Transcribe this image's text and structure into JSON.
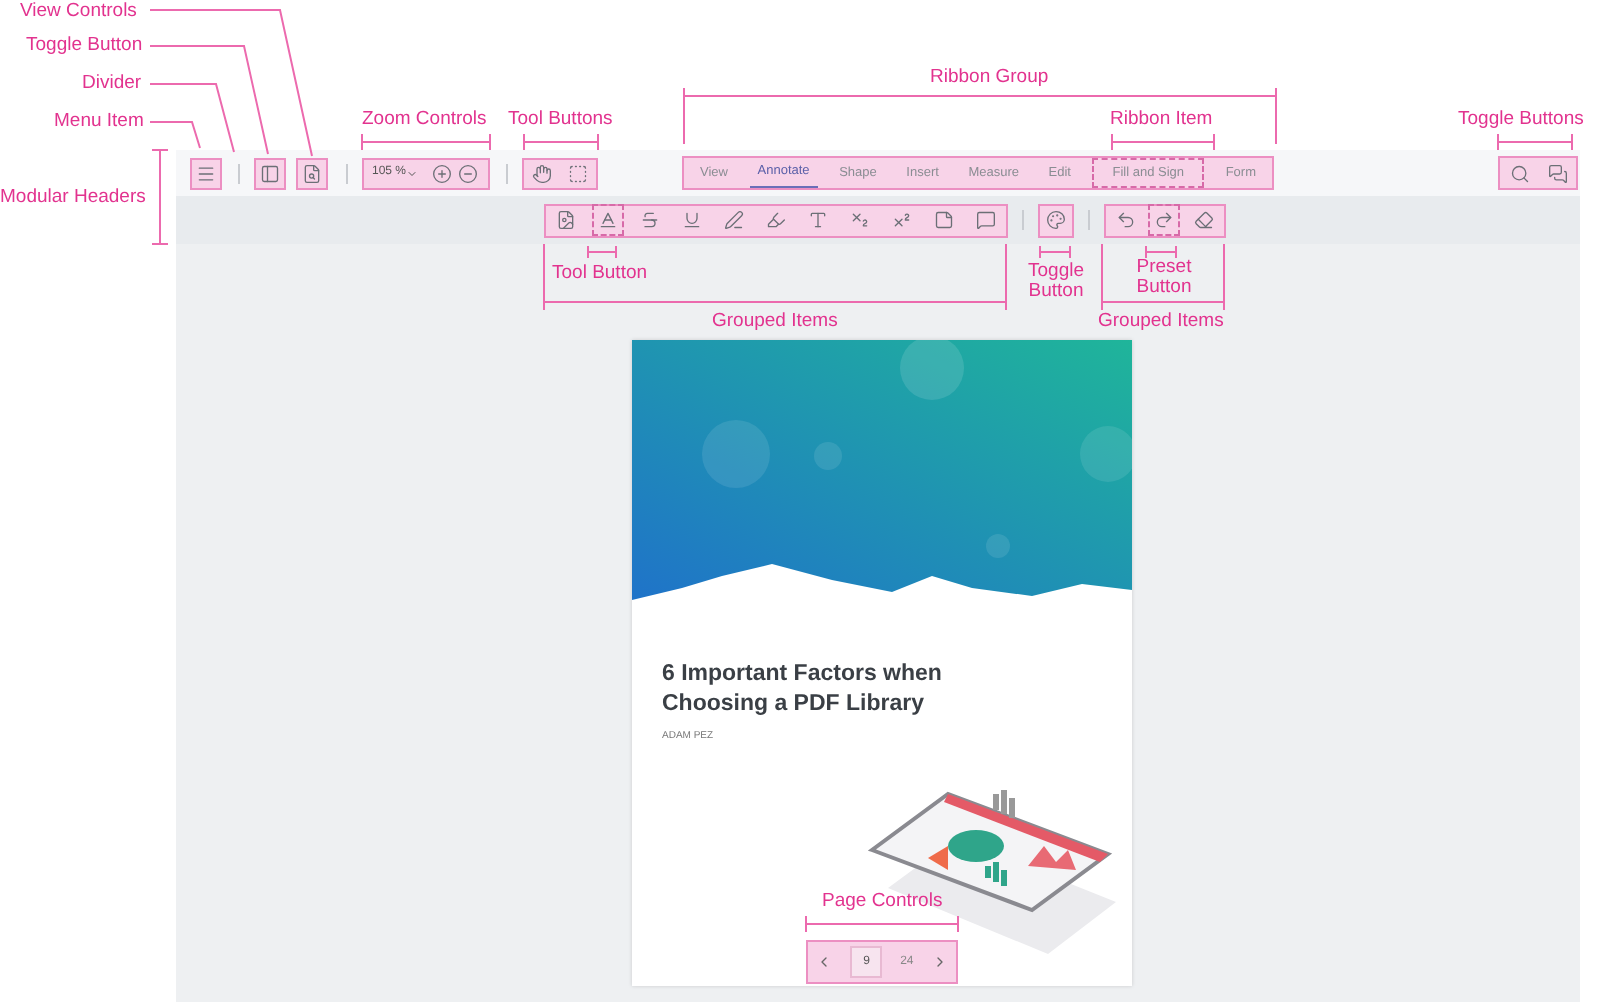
{
  "header_top": {
    "zoom": {
      "value": "105 %"
    },
    "ribbon": [
      {
        "label": "View",
        "selected": false,
        "outlined": false
      },
      {
        "label": "Annotate",
        "selected": true,
        "outlined": false
      },
      {
        "label": "Shape",
        "selected": false,
        "outlined": false
      },
      {
        "label": "Insert",
        "selected": false,
        "outlined": false
      },
      {
        "label": "Measure",
        "selected": false,
        "outlined": false
      },
      {
        "label": "Edit",
        "selected": false,
        "outlined": false
      },
      {
        "label": "Fill and Sign",
        "selected": false,
        "outlined": true
      },
      {
        "label": "Form",
        "selected": false,
        "outlined": false
      }
    ]
  },
  "header_tools": {
    "tools": [
      {
        "outlined": false
      },
      {
        "outlined": true
      },
      {
        "outlined": false
      },
      {
        "outlined": false
      },
      {
        "outlined": false
      },
      {
        "outlined": false
      },
      {
        "outlined": false
      },
      {
        "outlined": false
      },
      {
        "outlined": false
      },
      {
        "outlined": false
      },
      {
        "outlined": false
      }
    ],
    "history": [
      {
        "outlined": false
      },
      {
        "outlined": true
      },
      {
        "outlined": false
      }
    ]
  },
  "document": {
    "title": "6 Important Factors when Choosing a PDF Library",
    "author": "ADAM PEZ"
  },
  "page_controls": {
    "current": "9",
    "total": "24"
  },
  "annotations": [
    {
      "text": "View Controls"
    },
    {
      "text": "Toggle Button"
    },
    {
      "text": "Divider"
    },
    {
      "text": "Ribbon Group"
    },
    {
      "text": "Menu Item"
    },
    {
      "text": "Zoom Controls"
    },
    {
      "text": "Tool Buttons"
    },
    {
      "text": "Ribbon Item"
    },
    {
      "text": "Toggle Buttons"
    },
    {
      "text": "Modular Headers"
    },
    {
      "text": "Tool Button"
    },
    {
      "text": "Toggle Button"
    },
    {
      "text": "Preset Button"
    },
    {
      "text": "Grouped Items"
    },
    {
      "text": "Grouped Items"
    },
    {
      "text": "Page Controls"
    }
  ]
}
